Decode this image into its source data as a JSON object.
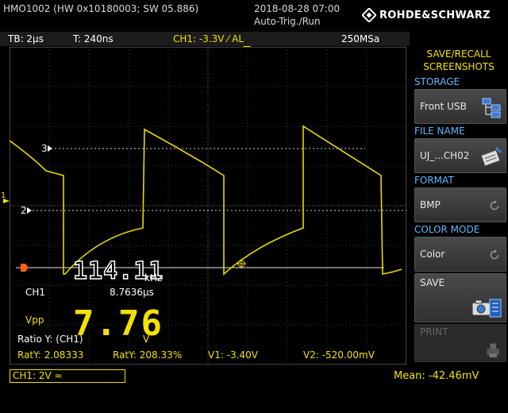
{
  "header": {
    "device_title": "HMO1002 (HW 0x10180003; SW 05.886)",
    "datetime": "2018-08-28 07:00",
    "trigger_mode": "Auto-Trig./Run",
    "brand": "ROHDE&SCHWARZ"
  },
  "status": {
    "timebase": "TB: 2µs",
    "trigger_time": "T: 240ns",
    "trigger": "CH1: -3.3V ⁄ AL",
    "sample_rate": "250MSa"
  },
  "side_panel": {
    "title_line1": "SAVE/RECALL",
    "title_line2": "SCREENSHOTS",
    "storage_label": "STORAGE",
    "storage_value": "Front USB",
    "file_name_label": "FILE NAME",
    "file_name_value": "UJ_...CH02",
    "format_label": "FORMAT",
    "format_value": "BMP",
    "color_mode_label": "COLOR MODE",
    "color_mode_value": "Color",
    "save_label": "SAVE",
    "print_label": "PRINT"
  },
  "measurements": {
    "frequency_value": "114.11",
    "frequency_unit": "kHz",
    "channel": "CH1",
    "period": "8.7636µs",
    "vpp_label": "Vpp",
    "vpp_value": "7.76",
    "vpp_unit": "V",
    "ratio_label": "Ratio Y: (CH1)",
    "raty1": "RatY: 2.08333",
    "raty2": "RatY: 208.33%",
    "v1": "V1: -3.40V",
    "v2": "V2: -520.00mV"
  },
  "markers": {
    "cursor3": "3",
    "cursor2": "2",
    "ch1_marker": "1",
    "trigger_marker": "T"
  },
  "bottom": {
    "channel_setting": "CH1: 2V ≈",
    "mean": "Mean: -42.46mV"
  },
  "colors": {
    "trace": "#e8d800",
    "accent_yellow": "#f2e200",
    "label_blue": "#5fb8ff",
    "trigger_orange": "#ff6010"
  }
}
